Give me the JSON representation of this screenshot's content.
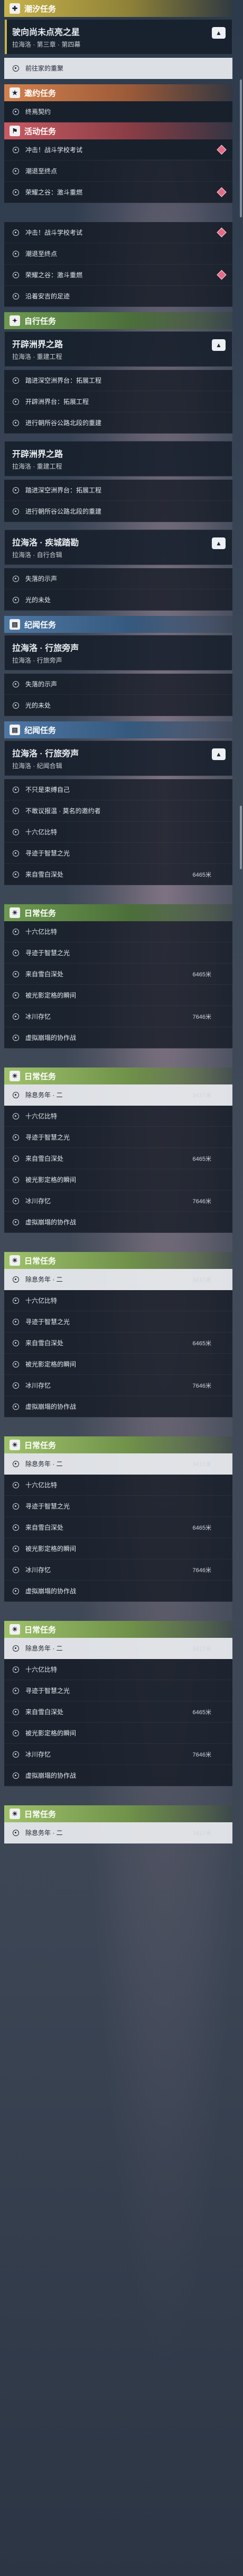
{
  "header_main": {
    "label": "潮汐任务",
    "icon": "plus-icon"
  },
  "main_quest": {
    "title": "驶向尚未点亮之星",
    "subtitle": "拉海洛 · 第三章 · 第四幕"
  },
  "main_item": "前往家的重聚",
  "header_invite": {
    "label": "邀约任务",
    "icon": "star-icon"
  },
  "invite_items": [
    "终焉契约"
  ],
  "header_event": {
    "label": "活动任务",
    "icon": "flag-icon"
  },
  "event_items_a": [
    "冲击！战斗学校考试",
    "潮退至终点",
    "荣耀之谷：激斗重燃"
  ],
  "event_items_b": [
    "冲击！战斗学校考试",
    "潮退至终点",
    "荣耀之谷：激斗重燃",
    "沿着安吉的足迹"
  ],
  "header_side": {
    "label": "自行任务",
    "icon": "star-icon"
  },
  "side_card1": {
    "title": "开辟洲界之路",
    "subtitle": "拉海洛 · 重建工程"
  },
  "side_items1": [
    "踏进深空洲界台：拓展工程",
    "开辟洲界台：拓展工程",
    "进行朝所谷公路北段的重建"
  ],
  "side_card2": {
    "title": "开辟洲界之路",
    "subtitle": "拉海洛 · 重建工程"
  },
  "side_items2": [
    "踏进深空洲界台：拓展工程",
    "进行朝所谷公路北段的重建"
  ],
  "side_card3": {
    "title": "拉海洛 · 疾城踏勘",
    "subtitle": "拉海洛 · 自行合辑"
  },
  "side_items3": [
    "失落的示声",
    "光的未处"
  ],
  "header_relic1": {
    "label": "纪闻任务",
    "icon": "book-icon"
  },
  "relic_card1": {
    "title": "拉海洛 · 行旅旁声",
    "subtitle": "拉海洛 · 行旅旁声"
  },
  "relic_items1": [
    "失落的示声",
    "光的未处"
  ],
  "header_relic2": {
    "label": "纪闻任务",
    "icon": "book-icon"
  },
  "relic_card2": {
    "title": "拉海洛 · 行旅旁声",
    "subtitle": "拉海洛 · 纪闻合辑"
  },
  "relic_items2": [
    {
      "label": "不只是束缚自己",
      "dist": ""
    },
    {
      "label": "不敢议报温 · 莫名的邀约者",
      "dist": ""
    },
    {
      "label": "十六亿比特",
      "dist": ""
    },
    {
      "label": "寻迹于智慧之光",
      "dist": ""
    },
    {
      "label": "来自雪白深处",
      "dist": "6465米"
    }
  ],
  "daily_sections": [
    {
      "label": "日常任务",
      "icon": "sun-icon",
      "headerClass": "hdr-green",
      "items": [
        {
          "label": "十六亿比特",
          "dist": ""
        },
        {
          "label": "寻迹于智慧之光",
          "dist": ""
        },
        {
          "label": "来自雪白深处",
          "dist": "6465米"
        },
        {
          "label": "被光影定格的瞬间",
          "dist": ""
        },
        {
          "label": "冰川存忆",
          "dist": "7646米"
        },
        {
          "label": "虚拟崩塌的协作战",
          "dist": ""
        }
      ]
    },
    {
      "label": "日常任务",
      "icon": "sun-icon",
      "headerClass": "hdr-lime",
      "selected": {
        "label": "除息务年 · 二",
        "dist": "3417米"
      },
      "items": [
        {
          "label": "十六亿比特",
          "dist": ""
        },
        {
          "label": "寻迹于智慧之光",
          "dist": ""
        },
        {
          "label": "来自雪白深处",
          "dist": "6465米"
        },
        {
          "label": "被光影定格的瞬间",
          "dist": ""
        },
        {
          "label": "冰川存忆",
          "dist": "7646米"
        },
        {
          "label": "虚拟崩塌的协作战",
          "dist": ""
        }
      ]
    },
    {
      "label": "日常任务",
      "icon": "sun-icon",
      "headerClass": "hdr-lime",
      "selected": {
        "label": "除息务年 · 二",
        "dist": "3417米"
      },
      "items": [
        {
          "label": "十六亿比特",
          "dist": ""
        },
        {
          "label": "寻迹于智慧之光",
          "dist": ""
        },
        {
          "label": "来自雪白深处",
          "dist": "6465米"
        },
        {
          "label": "被光影定格的瞬间",
          "dist": ""
        },
        {
          "label": "冰川存忆",
          "dist": "7646米"
        },
        {
          "label": "虚拟崩塌的协作战",
          "dist": ""
        }
      ]
    },
    {
      "label": "日常任务",
      "icon": "sun-icon",
      "headerClass": "hdr-lime",
      "selected": {
        "label": "除息务年 · 二",
        "dist": "3417米"
      },
      "items": [
        {
          "label": "十六亿比特",
          "dist": ""
        },
        {
          "label": "寻迹于智慧之光",
          "dist": ""
        },
        {
          "label": "来自雪白深处",
          "dist": "6465米"
        },
        {
          "label": "被光影定格的瞬间",
          "dist": ""
        },
        {
          "label": "冰川存忆",
          "dist": "7646米"
        },
        {
          "label": "虚拟崩塌的协作战",
          "dist": ""
        }
      ]
    },
    {
      "label": "日常任务",
      "icon": "sun-icon",
      "headerClass": "hdr-lime",
      "selected": {
        "label": "除息务年 · 二",
        "dist": "3417米"
      },
      "items": [
        {
          "label": "十六亿比特",
          "dist": ""
        },
        {
          "label": "寻迹于智慧之光",
          "dist": ""
        },
        {
          "label": "来自雪白深处",
          "dist": "6465米"
        },
        {
          "label": "被光影定格的瞬间",
          "dist": ""
        },
        {
          "label": "冰川存忆",
          "dist": "7646米"
        },
        {
          "label": "虚拟崩塌的协作战",
          "dist": ""
        }
      ]
    },
    {
      "label": "日常任务",
      "icon": "sun-icon",
      "headerClass": "hdr-lime",
      "selected": {
        "label": "除息务年 · 二",
        "dist": "3417米"
      },
      "items": []
    }
  ],
  "colors": {
    "accent_yellow": "#c7b24a",
    "accent_orange": "#d4814d",
    "accent_red": "#c85a62",
    "accent_green": "#6d9a4e",
    "accent_blue": "#4d77a4",
    "marker_pink": "#e36b85"
  }
}
